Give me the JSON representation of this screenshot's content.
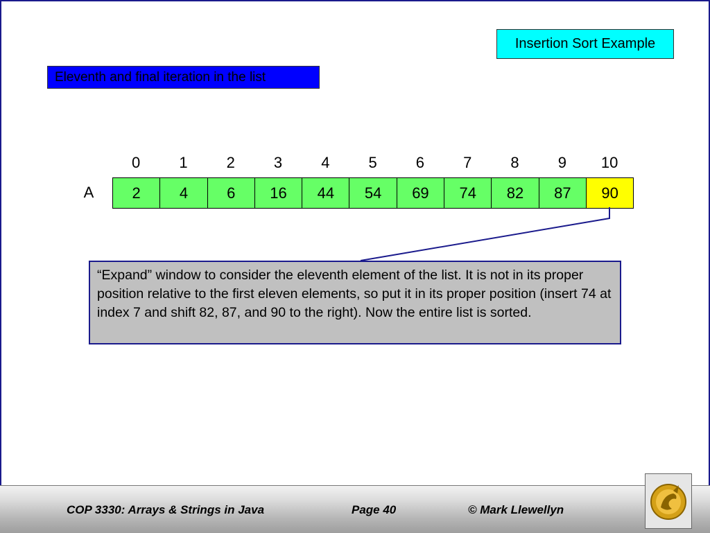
{
  "slide": {
    "title": "Insertion Sort Example",
    "subtitle": "Eleventh and final iteration in the list"
  },
  "array": {
    "name": "A",
    "indices": [
      "0",
      "1",
      "2",
      "3",
      "4",
      "5",
      "6",
      "7",
      "8",
      "9",
      "10"
    ],
    "values": [
      "2",
      "4",
      "6",
      "16",
      "44",
      "54",
      "69",
      "74",
      "82",
      "87",
      "90"
    ],
    "highlighted_index": 10
  },
  "note": {
    "text": "“Expand” window to consider the eleventh element of the list.  It is not in its proper position relative to the first eleven elements, so put it in its proper position (insert 74 at index 7 and shift 82, 87, and 90 to the right).  Now the entire list is sorted."
  },
  "footer": {
    "course": "COP 3330:  Arrays & Strings in Java",
    "page": "Page 40",
    "author": "© Mark Llewellyn"
  },
  "colors": {
    "title_bg": "#00ffff",
    "subtitle_bg": "#0000ff",
    "cell_bg": "#66ff66",
    "highlight_bg": "#ffff00",
    "note_bg": "#c0c0c0",
    "line": "#1a1a8c"
  }
}
